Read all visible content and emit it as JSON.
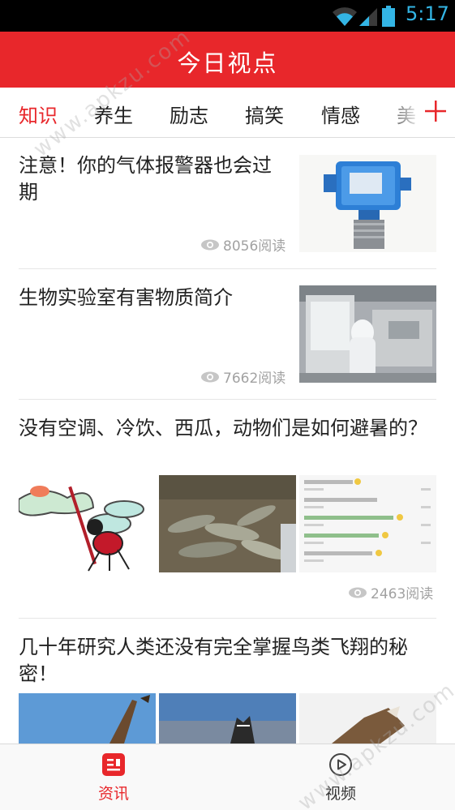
{
  "status_bar": {
    "time": "5:17",
    "time_color": "#33b5e5",
    "icons": [
      "wifi-icon",
      "signal-icon",
      "battery-icon"
    ]
  },
  "header": {
    "title": "今日视点",
    "background": "#e8272b"
  },
  "tabs": {
    "items": [
      {
        "label": "知识",
        "active": true
      },
      {
        "label": "养生",
        "active": false
      },
      {
        "label": "励志",
        "active": false
      },
      {
        "label": "搞笑",
        "active": false
      },
      {
        "label": "情感",
        "active": false
      },
      {
        "label": "美",
        "active": false
      }
    ],
    "add_icon": "plus-icon",
    "active_color": "#e8272b"
  },
  "feed": {
    "items": [
      {
        "title": "注意！你的气体报警器也会过期",
        "reads": "8056阅读",
        "thumbnail": "gas-detector-image"
      },
      {
        "title": "生物实验室有害物质简介",
        "reads": "7662阅读",
        "thumbnail": "lab-worker-image"
      },
      {
        "title": "没有空调、冷饮、西瓜，动物们是如何避暑的？",
        "reads": "2463阅读",
        "thumbnails": [
          "mosquito-cartoon-image",
          "fish-pile-image",
          "chat-screenshot-image"
        ]
      },
      {
        "title": "几十年研究人类还没有完全掌握鸟类飞翔的秘密！",
        "thumbnails": [
          "eagle-image-1",
          "eagle-image-2",
          "eagle-image-3"
        ]
      }
    ]
  },
  "bottom_nav": {
    "items": [
      {
        "label": "资讯",
        "icon": "news-icon",
        "active": true
      },
      {
        "label": "视频",
        "icon": "play-circle-icon",
        "active": false
      }
    ]
  },
  "watermark": "www.apkzu.com"
}
